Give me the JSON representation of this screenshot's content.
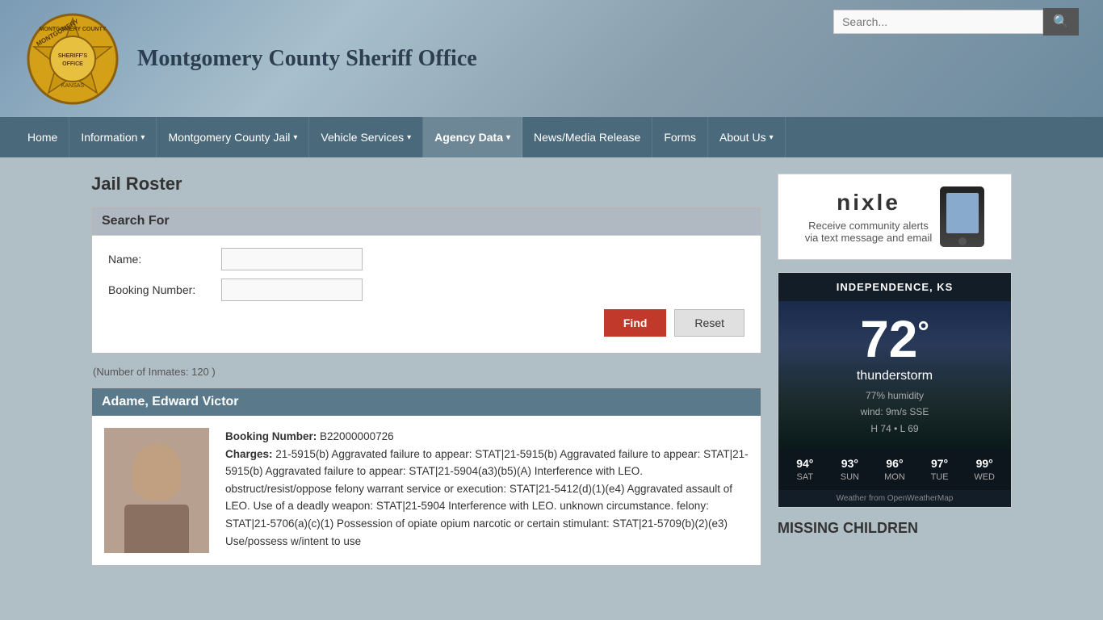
{
  "header": {
    "title": "Montgomery County Sheriff Office",
    "search_placeholder": "Search..."
  },
  "nav": {
    "items": [
      {
        "id": "home",
        "label": "Home",
        "has_arrow": false
      },
      {
        "id": "information",
        "label": "Information",
        "has_arrow": true
      },
      {
        "id": "jail",
        "label": "Montgomery County Jail",
        "has_arrow": true
      },
      {
        "id": "vehicle",
        "label": "Vehicle Services",
        "has_arrow": true
      },
      {
        "id": "agency",
        "label": "Agency Data",
        "has_arrow": true,
        "active": true
      },
      {
        "id": "news",
        "label": "News/Media Release",
        "has_arrow": false
      },
      {
        "id": "forms",
        "label": "Forms",
        "has_arrow": false
      },
      {
        "id": "about",
        "label": "About Us",
        "has_arrow": true
      }
    ]
  },
  "page": {
    "title": "Jail Roster",
    "search_section_label": "Search For",
    "form": {
      "name_label": "Name:",
      "booking_label": "Booking Number:",
      "find_button": "Find",
      "reset_button": "Reset"
    },
    "inmates_count": "(Number of Inmates: 120 )"
  },
  "inmate": {
    "name": "Adame, Edward Victor",
    "booking_number_label": "Booking Number:",
    "booking_number": "B22000000726",
    "charges_label": "Charges:",
    "charges": "21-5915(b) Aggravated failure to appear: STAT|21-5915(b) Aggravated failure to appear: STAT|21-5915(b) Aggravated failure to appear: STAT|21-5904(a3)(b5)(A) Interference with LEO. obstruct/resist/oppose felony warrant service or execution: STAT|21-5412(d)(1)(e4) Aggravated assault of LEO.\nUse of a deadly weapon: STAT|21-5904 Interference with LEO. unknown circumstance.\nfelony: STAT|21-5706(a)(c)(1) Possession of opiate opium narcotic or certain stimulant: STAT|21-5709(b)(2)(e3) Use/possess w/intent to use"
  },
  "nixle": {
    "logo_text": "nixle",
    "description": "Receive community alerts\nvia text message and email"
  },
  "weather": {
    "location": "INDEPENDENCE, KS",
    "temp": "72",
    "temp_symbol": "°",
    "condition": "thunderstorm",
    "humidity": "77% humidity",
    "wind": "wind: 9m/s SSE",
    "high_low": "H 74 • L 69",
    "forecast": [
      {
        "day": "SAT",
        "temp": "94°"
      },
      {
        "day": "SUN",
        "temp": "93°"
      },
      {
        "day": "MON",
        "temp": "96°"
      },
      {
        "day": "TUE",
        "temp": "97°"
      },
      {
        "day": "WED",
        "temp": "99°"
      }
    ],
    "attribution": "Weather from OpenWeatherMap"
  },
  "missing_children": {
    "title": "MISSING CHILDREN"
  }
}
